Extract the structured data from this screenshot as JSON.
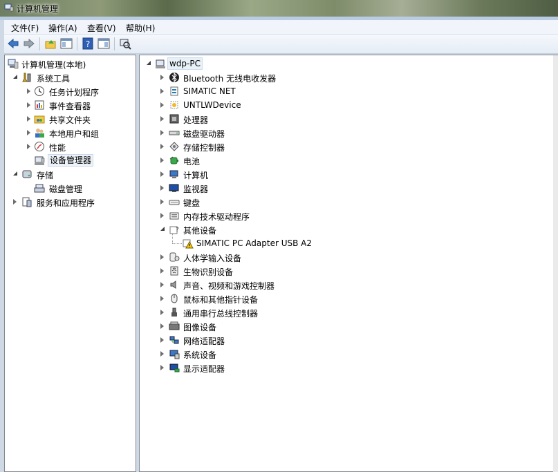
{
  "window": {
    "title": "计算机管理"
  },
  "menu": [
    "文件(F)",
    "操作(A)",
    "查看(V)",
    "帮助(H)"
  ],
  "toolbar": [
    "back-icon",
    "forward-icon",
    "up-folder-icon",
    "show-hide-tree-icon",
    "help-icon",
    "properties-icon",
    "scan-hardware-icon"
  ],
  "left_tree": {
    "root": "计算机管理(本地)",
    "system_tools": "系统工具",
    "system_children": [
      "任务计划程序",
      "事件查看器",
      "共享文件夹",
      "本地用户和组",
      "性能",
      "设备管理器"
    ],
    "storage": "存储",
    "storage_children": [
      "磁盘管理"
    ],
    "services": "服务和应用程序"
  },
  "device_tree": {
    "root": "wdp-PC",
    "categories": [
      {
        "label": "Bluetooth 无线电收发器",
        "icon": "bluetooth-icon"
      },
      {
        "label": "SIMATIC NET",
        "icon": "simatic-net-icon"
      },
      {
        "label": "UNTLWDevice",
        "icon": "device-icon"
      },
      {
        "label": "处理器",
        "icon": "processor-icon"
      },
      {
        "label": "磁盘驱动器",
        "icon": "disk-drive-icon"
      },
      {
        "label": "存储控制器",
        "icon": "storage-controller-icon"
      },
      {
        "label": "电池",
        "icon": "battery-icon"
      },
      {
        "label": "计算机",
        "icon": "computer-icon"
      },
      {
        "label": "监视器",
        "icon": "monitor-icon"
      },
      {
        "label": "键盘",
        "icon": "keyboard-icon"
      },
      {
        "label": "内存技术驱动程序",
        "icon": "memory-icon"
      },
      {
        "label": "其他设备",
        "icon": "other-devices-icon",
        "expanded": true,
        "children": [
          {
            "label": "SIMATIC PC Adapter USB A2",
            "icon": "warning-device-icon"
          }
        ]
      },
      {
        "label": "人体学输入设备",
        "icon": "hid-icon"
      },
      {
        "label": "生物识别设备",
        "icon": "biometric-icon"
      },
      {
        "label": "声音、视频和游戏控制器",
        "icon": "sound-icon"
      },
      {
        "label": "鼠标和其他指针设备",
        "icon": "mouse-icon"
      },
      {
        "label": "通用串行总线控制器",
        "icon": "usb-icon"
      },
      {
        "label": "图像设备",
        "icon": "imaging-icon"
      },
      {
        "label": "网络适配器",
        "icon": "network-icon"
      },
      {
        "label": "系统设备",
        "icon": "system-device-icon"
      },
      {
        "label": "显示适配器",
        "icon": "display-adapter-icon"
      }
    ]
  }
}
